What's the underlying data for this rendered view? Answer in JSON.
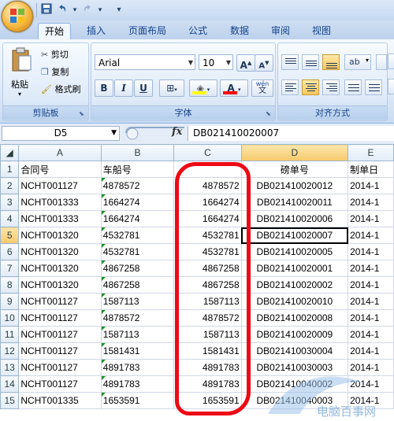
{
  "quick_access": {
    "save_icon": "save-icon",
    "undo_icon": "undo-icon",
    "redo_icon": "redo-icon",
    "customize_icon": "chevron-down-icon"
  },
  "tabs": [
    {
      "label": "开始",
      "active": true
    },
    {
      "label": "插入",
      "active": false
    },
    {
      "label": "页面布局",
      "active": false
    },
    {
      "label": "公式",
      "active": false
    },
    {
      "label": "数据",
      "active": false
    },
    {
      "label": "审阅",
      "active": false
    },
    {
      "label": "视图",
      "active": false
    }
  ],
  "ribbon": {
    "clipboard": {
      "paste": "粘贴",
      "cut": "剪切",
      "copy": "复制",
      "format_painter": "格式刷",
      "label": "剪贴板"
    },
    "font": {
      "name": "Arial",
      "size": "10",
      "bold": "B",
      "italic": "I",
      "underline": "U",
      "grow": "A",
      "shrink": "A",
      "label": "字体",
      "wen": "wén",
      "wen2": "文"
    },
    "alignment": {
      "label": "对齐方式"
    }
  },
  "formula_bar": {
    "name_box": "D5",
    "fx": "fx",
    "formula": "DB021410020007"
  },
  "columns": [
    "A",
    "B",
    "C",
    "D",
    "E"
  ],
  "rows": [
    {
      "n": "1",
      "a": "合同号",
      "b": "车船号",
      "c": "",
      "d": "磅单号",
      "e": "制单日"
    },
    {
      "n": "2",
      "a": "NCHT001127",
      "b": "4878572",
      "c": "4878572",
      "d": "DB021410020012",
      "e": "2014-1"
    },
    {
      "n": "3",
      "a": "NCHT001333",
      "b": "1664274",
      "c": "1664274",
      "d": "DB021410020011",
      "e": "2014-1"
    },
    {
      "n": "4",
      "a": "NCHT001333",
      "b": "1664274",
      "c": "1664274",
      "d": "DB021410020006",
      "e": "2014-1"
    },
    {
      "n": "5",
      "a": "NCHT001320",
      "b": "4532781",
      "c": "4532781",
      "d": "DB021410020007",
      "e": "2014-1"
    },
    {
      "n": "6",
      "a": "NCHT001320",
      "b": "4532781",
      "c": "4532781",
      "d": "DB021410020005",
      "e": "2014-1"
    },
    {
      "n": "7",
      "a": "NCHT001320",
      "b": "4867258",
      "c": "4867258",
      "d": "DB021410020001",
      "e": "2014-1"
    },
    {
      "n": "8",
      "a": "NCHT001320",
      "b": "4867258",
      "c": "4867258",
      "d": "DB021410020002",
      "e": "2014-1"
    },
    {
      "n": "9",
      "a": "NCHT001127",
      "b": "1587113",
      "c": "1587113",
      "d": "DB021410020010",
      "e": "2014-1"
    },
    {
      "n": "10",
      "a": "NCHT001127",
      "b": "4878572",
      "c": "4878572",
      "d": "DB021410020008",
      "e": "2014-1"
    },
    {
      "n": "11",
      "a": "NCHT001127",
      "b": "1587113",
      "c": "1587113",
      "d": "DB021410020009",
      "e": "2014-1"
    },
    {
      "n": "12",
      "a": "NCHT001127",
      "b": "1581431",
      "c": "1581431",
      "d": "DB021410030004",
      "e": "2014-1"
    },
    {
      "n": "13",
      "a": "NCHT001127",
      "b": "4891783",
      "c": "4891783",
      "d": "DB021410030003",
      "e": "2014-1"
    },
    {
      "n": "14",
      "a": "NCHT001127",
      "b": "4891783",
      "c": "4891783",
      "d": "DB021410040002",
      "e": "2014-1"
    },
    {
      "n": "15",
      "a": "NCHT001335",
      "b": "1653591",
      "c": "1653591",
      "d": "DB021410040003",
      "e": "2014-1"
    }
  ],
  "selected_cell": "D5",
  "colors": {
    "annotation": "#ee0a14",
    "ribbon_accent": "#15428b",
    "text_flag": "#1c8f2a"
  },
  "watermark": {
    "text": "电脑百事网"
  }
}
